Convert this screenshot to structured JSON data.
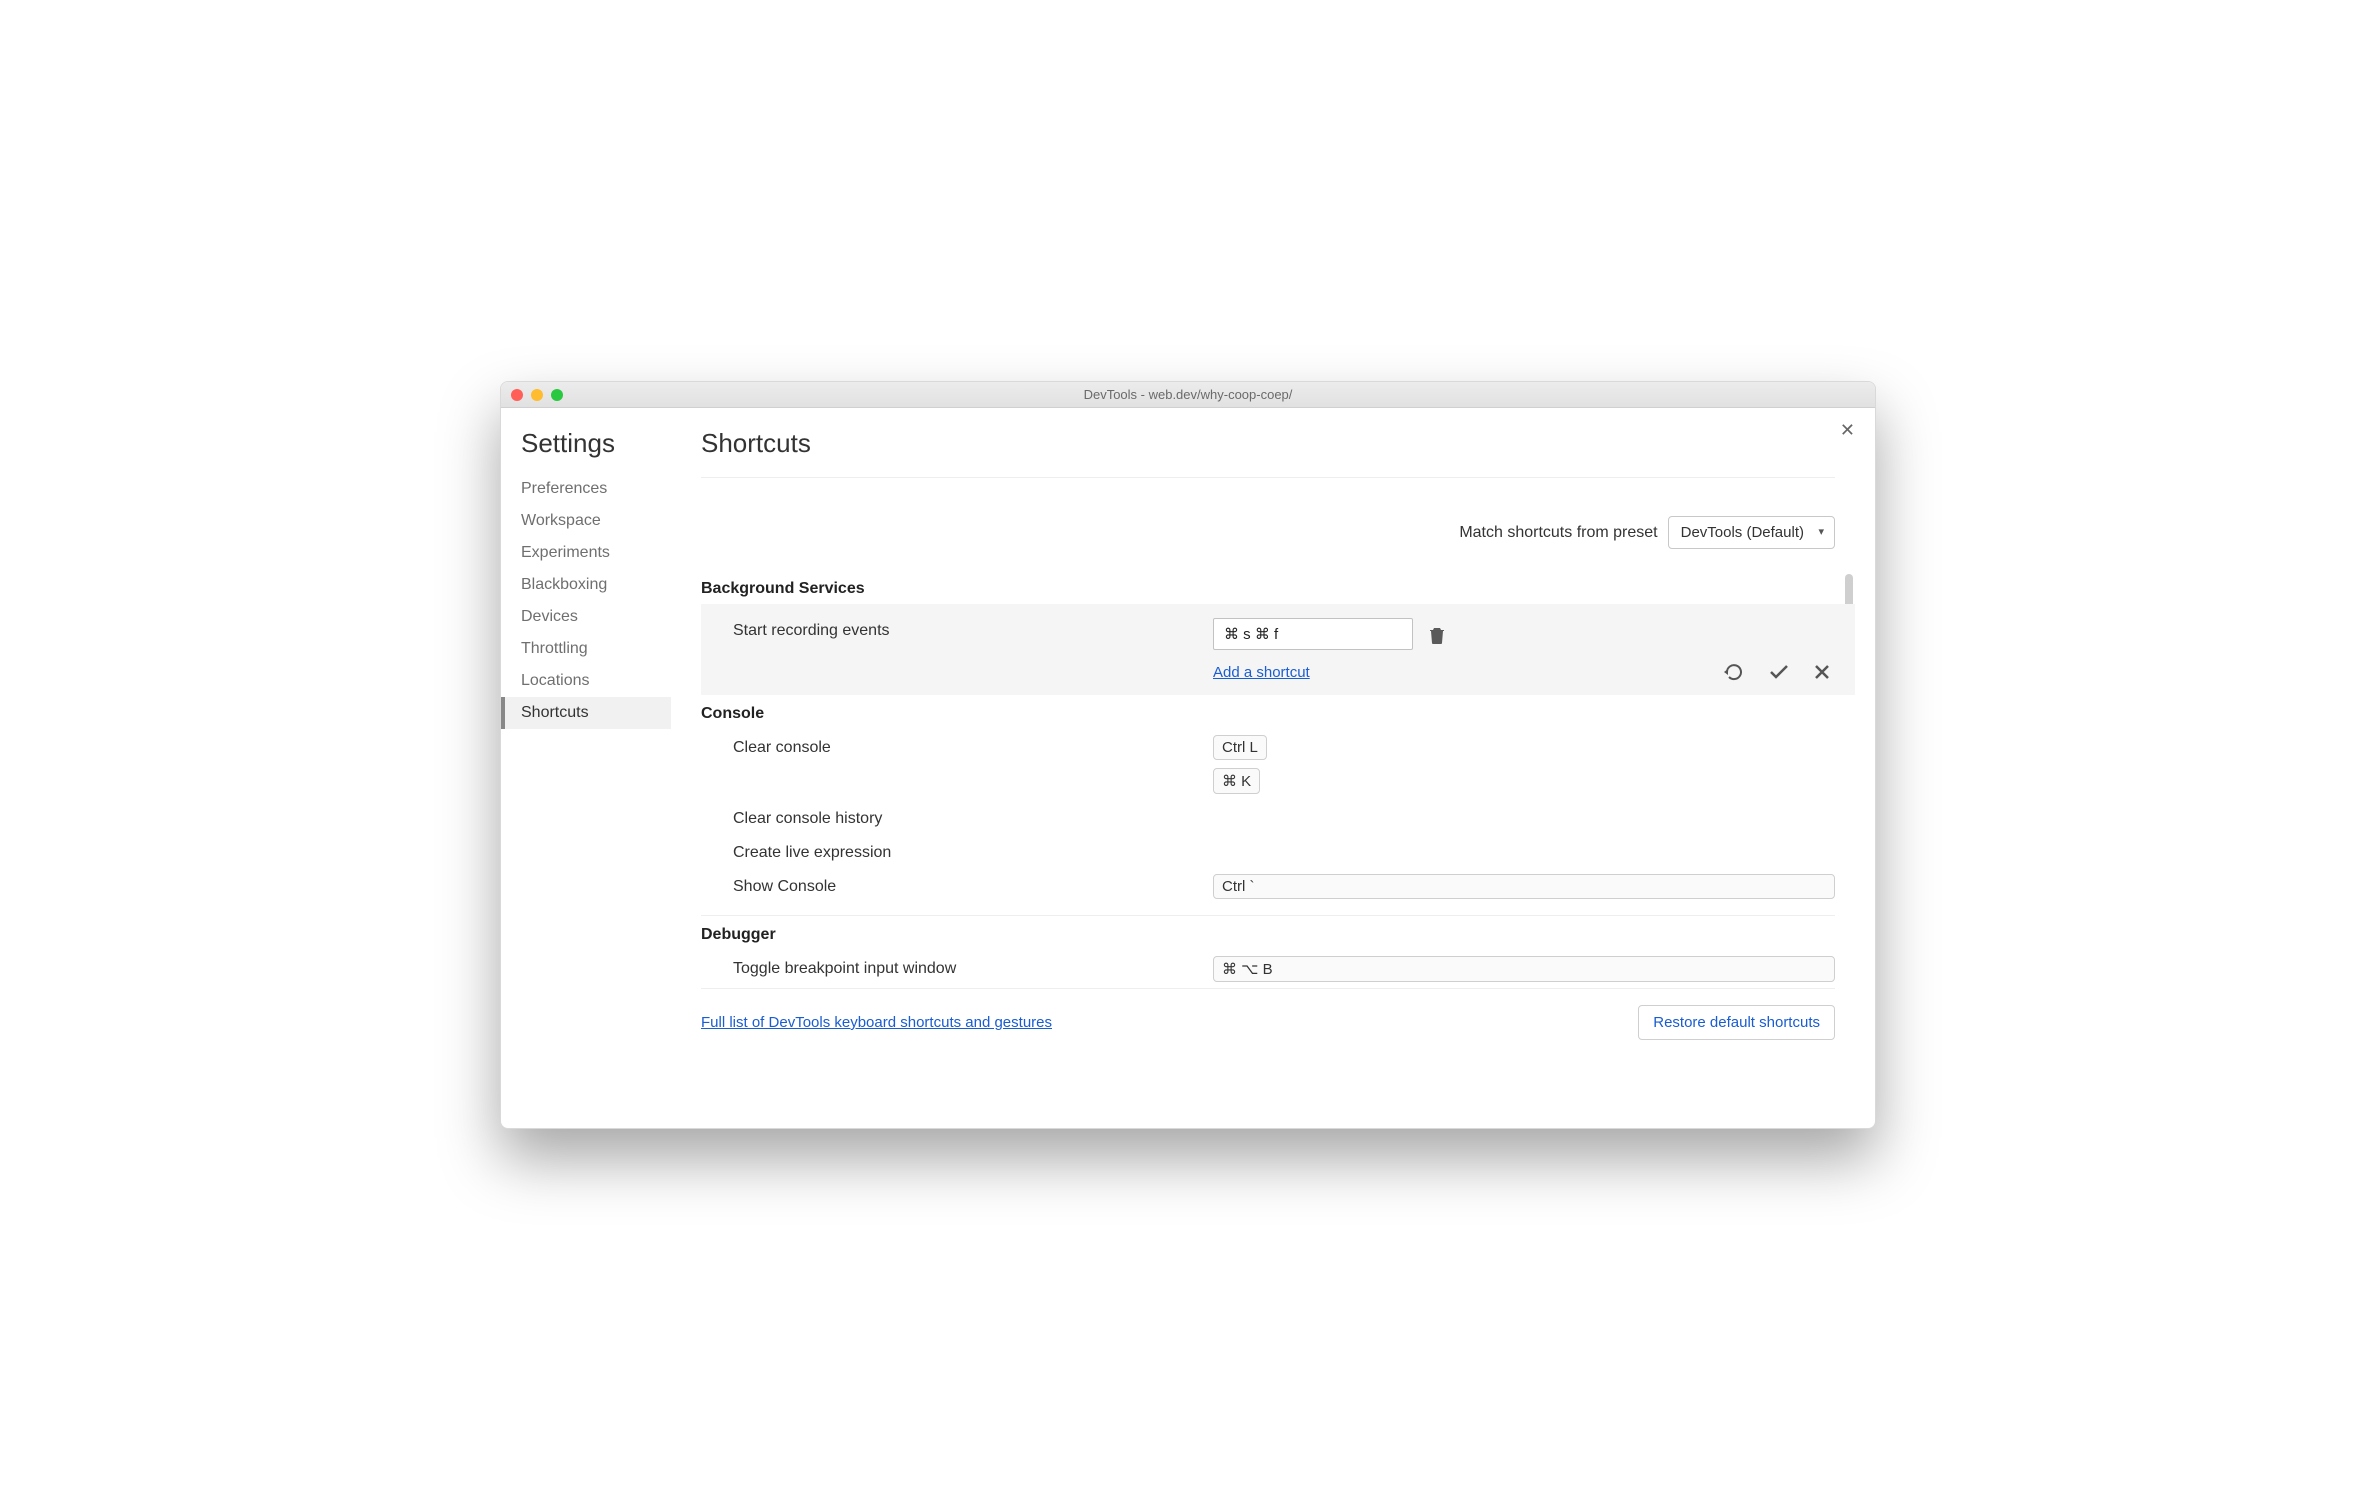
{
  "window": {
    "title": "DevTools - web.dev/why-coop-coep/"
  },
  "sidebar": {
    "heading": "Settings",
    "items": [
      "Preferences",
      "Workspace",
      "Experiments",
      "Blackboxing",
      "Devices",
      "Throttling",
      "Locations",
      "Shortcuts"
    ],
    "activeIndex": 7
  },
  "page": {
    "title": "Shortcuts"
  },
  "preset": {
    "label": "Match shortcuts from preset",
    "value": "DevTools (Default)"
  },
  "sections": {
    "bg": {
      "title": "Background Services",
      "row0": {
        "label": "Start recording events",
        "input": "⌘ s ⌘ f",
        "addLink": "Add a shortcut"
      }
    },
    "console": {
      "title": "Console",
      "r0": {
        "label": "Clear console",
        "k0": "Ctrl L",
        "k1": "⌘ K"
      },
      "r1": {
        "label": "Clear console history"
      },
      "r2": {
        "label": "Create live expression"
      },
      "r3": {
        "label": "Show Console",
        "k0": "Ctrl `"
      }
    },
    "debugger": {
      "title": "Debugger",
      "r0": {
        "label": "Toggle breakpoint input window",
        "k0": "⌘ ⌥ B"
      }
    }
  },
  "footer": {
    "link": "Full list of DevTools keyboard shortcuts and gestures",
    "restore": "Restore default shortcuts"
  }
}
